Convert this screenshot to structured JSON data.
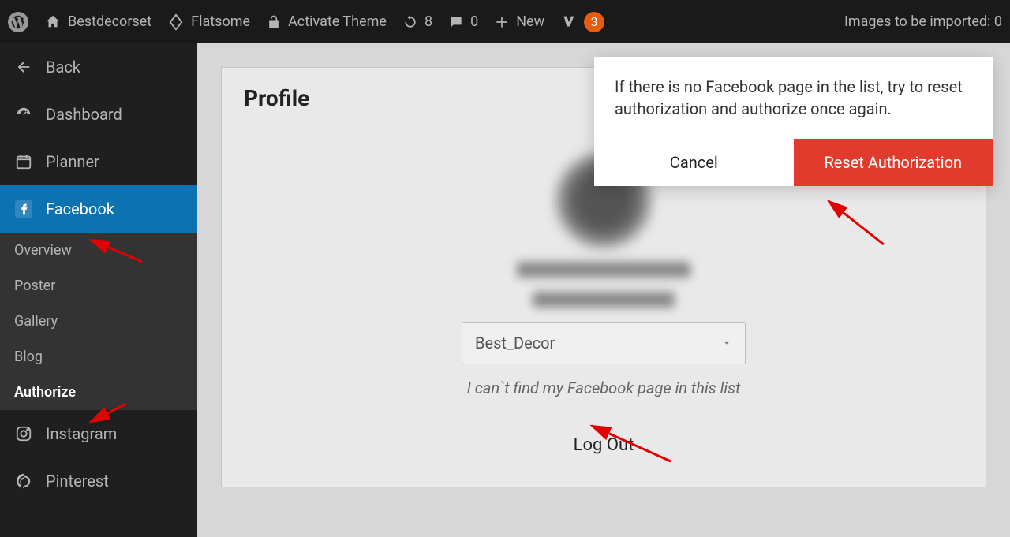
{
  "adminbar": {
    "site_name": "Bestdecorset",
    "theme_name": "Flatsome",
    "activate_theme": "Activate Theme",
    "updates_count": "8",
    "comments_count": "0",
    "new_label": "New",
    "yoast_badge": "3",
    "images_import": "Images to be imported: 0"
  },
  "sidebar": {
    "back": "Back",
    "dashboard": "Dashboard",
    "planner": "Planner",
    "facebook": "Facebook",
    "sub": {
      "overview": "Overview",
      "poster": "Poster",
      "gallery": "Gallery",
      "blog": "Blog",
      "authorize": "Authorize"
    },
    "instagram": "Instagram",
    "pinterest": "Pinterest"
  },
  "profile": {
    "title": "Profile",
    "selected_page": "Best_Decor",
    "hint": "I can`t find my Facebook page in this list",
    "logout": "Log Out"
  },
  "dialog": {
    "message": "If there is no Facebook page in the list, try to reset authorization and authorize once again.",
    "cancel": "Cancel",
    "reset": "Reset Authorization"
  }
}
